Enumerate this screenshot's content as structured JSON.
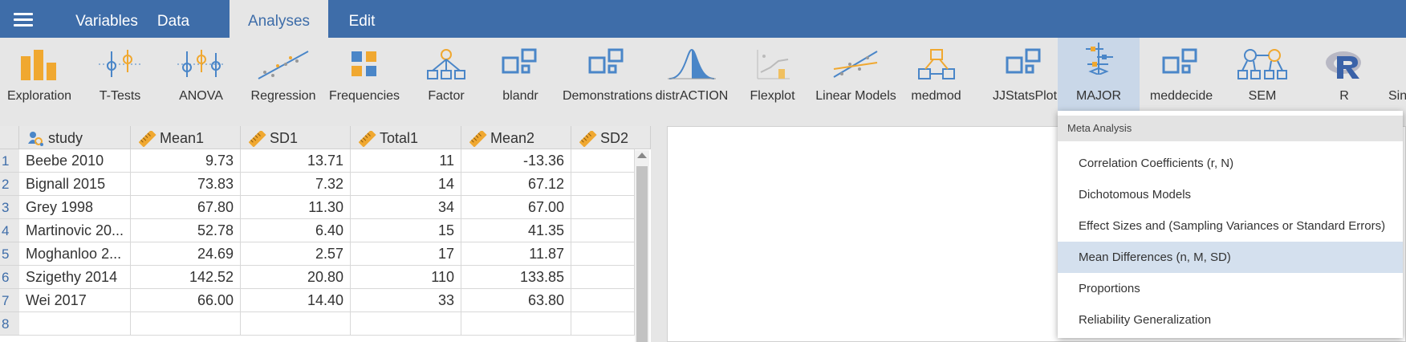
{
  "menu": {
    "tabs": [
      "Variables",
      "Data",
      "Analyses",
      "Edit"
    ],
    "active_tab": "Analyses"
  },
  "ribbon": {
    "items": [
      "Exploration",
      "T-Tests",
      "ANOVA",
      "Regression",
      "Frequencies",
      "Factor",
      "blandr",
      "Demonstrations",
      "distrACTION",
      "Flexplot",
      "Linear Models",
      "medmod",
      "JJStatsPlot",
      "MAJOR",
      "meddecide",
      "SEM",
      "R",
      "Sin"
    ],
    "selected": "MAJOR"
  },
  "spreadsheet": {
    "columns": [
      "study",
      "Mean1",
      "SD1",
      "Total1",
      "Mean2",
      "SD2"
    ],
    "row_numbers": [
      "1",
      "2",
      "3",
      "4",
      "5",
      "6",
      "7",
      "8"
    ],
    "rows": [
      [
        "Beebe 2010",
        "9.73",
        "13.71",
        "11",
        "-13.36",
        ""
      ],
      [
        "Bignall 2015",
        "73.83",
        "7.32",
        "14",
        "67.12",
        ""
      ],
      [
        "Grey 1998",
        "67.80",
        "11.30",
        "34",
        "67.00",
        ""
      ],
      [
        "Martinovic 20...",
        "52.78",
        "6.40",
        "15",
        "41.35",
        ""
      ],
      [
        "Moghanloo 2...",
        "24.69",
        "2.57",
        "17",
        "11.87",
        ""
      ],
      [
        "Szigethy 2014",
        "142.52",
        "20.80",
        "110",
        "133.85",
        ""
      ],
      [
        "Wei 2017",
        "66.00",
        "14.40",
        "33",
        "63.80",
        ""
      ],
      [
        "",
        "",
        "",
        "",
        "",
        ""
      ]
    ]
  },
  "dropdown": {
    "header": "Meta Analysis",
    "items": [
      "Correlation Coefficients (r, N)",
      "Dichotomous Models",
      "Effect Sizes and (Sampling Variances or Standard Errors)",
      "Mean Differences (n, M, SD)",
      "Proportions",
      "Reliability Generalization"
    ],
    "highlighted": "Mean Differences (n, M, SD)"
  },
  "colors": {
    "topbar": "#3e6da9",
    "ribbon_bg": "#e6e6e6",
    "accent_orange": "#f0a830",
    "accent_blue": "#4a86c8",
    "highlight": "#d4e0ee"
  }
}
